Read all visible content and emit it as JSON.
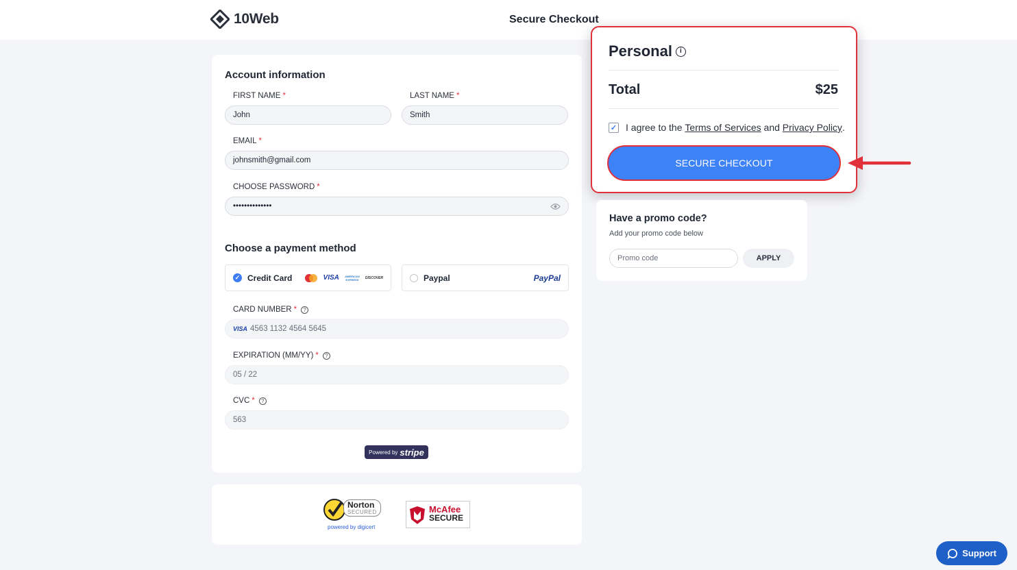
{
  "header": {
    "logo_text": "10Web",
    "title": "Secure Checkout"
  },
  "account": {
    "section_title": "Account information",
    "first_name_label": "FIRST NAME",
    "first_name_value": "John",
    "last_name_label": "LAST NAME",
    "last_name_value": "Smith",
    "email_label": "EMAIL",
    "email_value": "johnsmith@gmail.com",
    "password_label": "CHOOSE PASSWORD",
    "password_value": "••••••••••••••",
    "required_mark": "*"
  },
  "payment": {
    "section_title": "Choose a payment method",
    "options": [
      {
        "label": "Credit Card",
        "selected": true
      },
      {
        "label": "Paypal",
        "selected": false
      }
    ],
    "card_brands": [
      "mastercard-icon",
      "VISA",
      "AMERICAN EXPRESS",
      "DISCOVER"
    ],
    "paypal_brand": "PayPal",
    "card_number_label": "CARD NUMBER",
    "card_brand_tag": "VISA",
    "card_number_value": "4563 1132 4564 5645",
    "expiration_label": "EXPIRATION (MM/YY)",
    "expiration_value": "05 / 22",
    "cvc_label": "CVC",
    "cvc_value": "563",
    "powered_by": "Powered by",
    "stripe": "stripe"
  },
  "badges": {
    "norton_title": "Norton",
    "norton_sub": "SECURED",
    "norton_powered": "powered by digicert",
    "mcafee_title": "McAfee",
    "mcafee_sub": "SECURE"
  },
  "order": {
    "plan_name": "Personal",
    "total_label": "Total",
    "total_value": "$25",
    "agree_prefix": "I agree to the",
    "terms_link": "Terms of Services",
    "agree_and": "and",
    "privacy_link": "Privacy Policy",
    "agree_suffix": ".",
    "agree_checked": true,
    "checkout_button": "SECURE CHECKOUT"
  },
  "promo": {
    "title": "Have a promo code?",
    "subtitle": "Add your promo code below",
    "placeholder": "Promo code",
    "apply_button": "APPLY"
  },
  "support": {
    "label": "Support"
  },
  "colors": {
    "accent_blue": "#3d82f7",
    "highlight_red": "#e2303a",
    "support_blue": "#1e5fc8"
  }
}
